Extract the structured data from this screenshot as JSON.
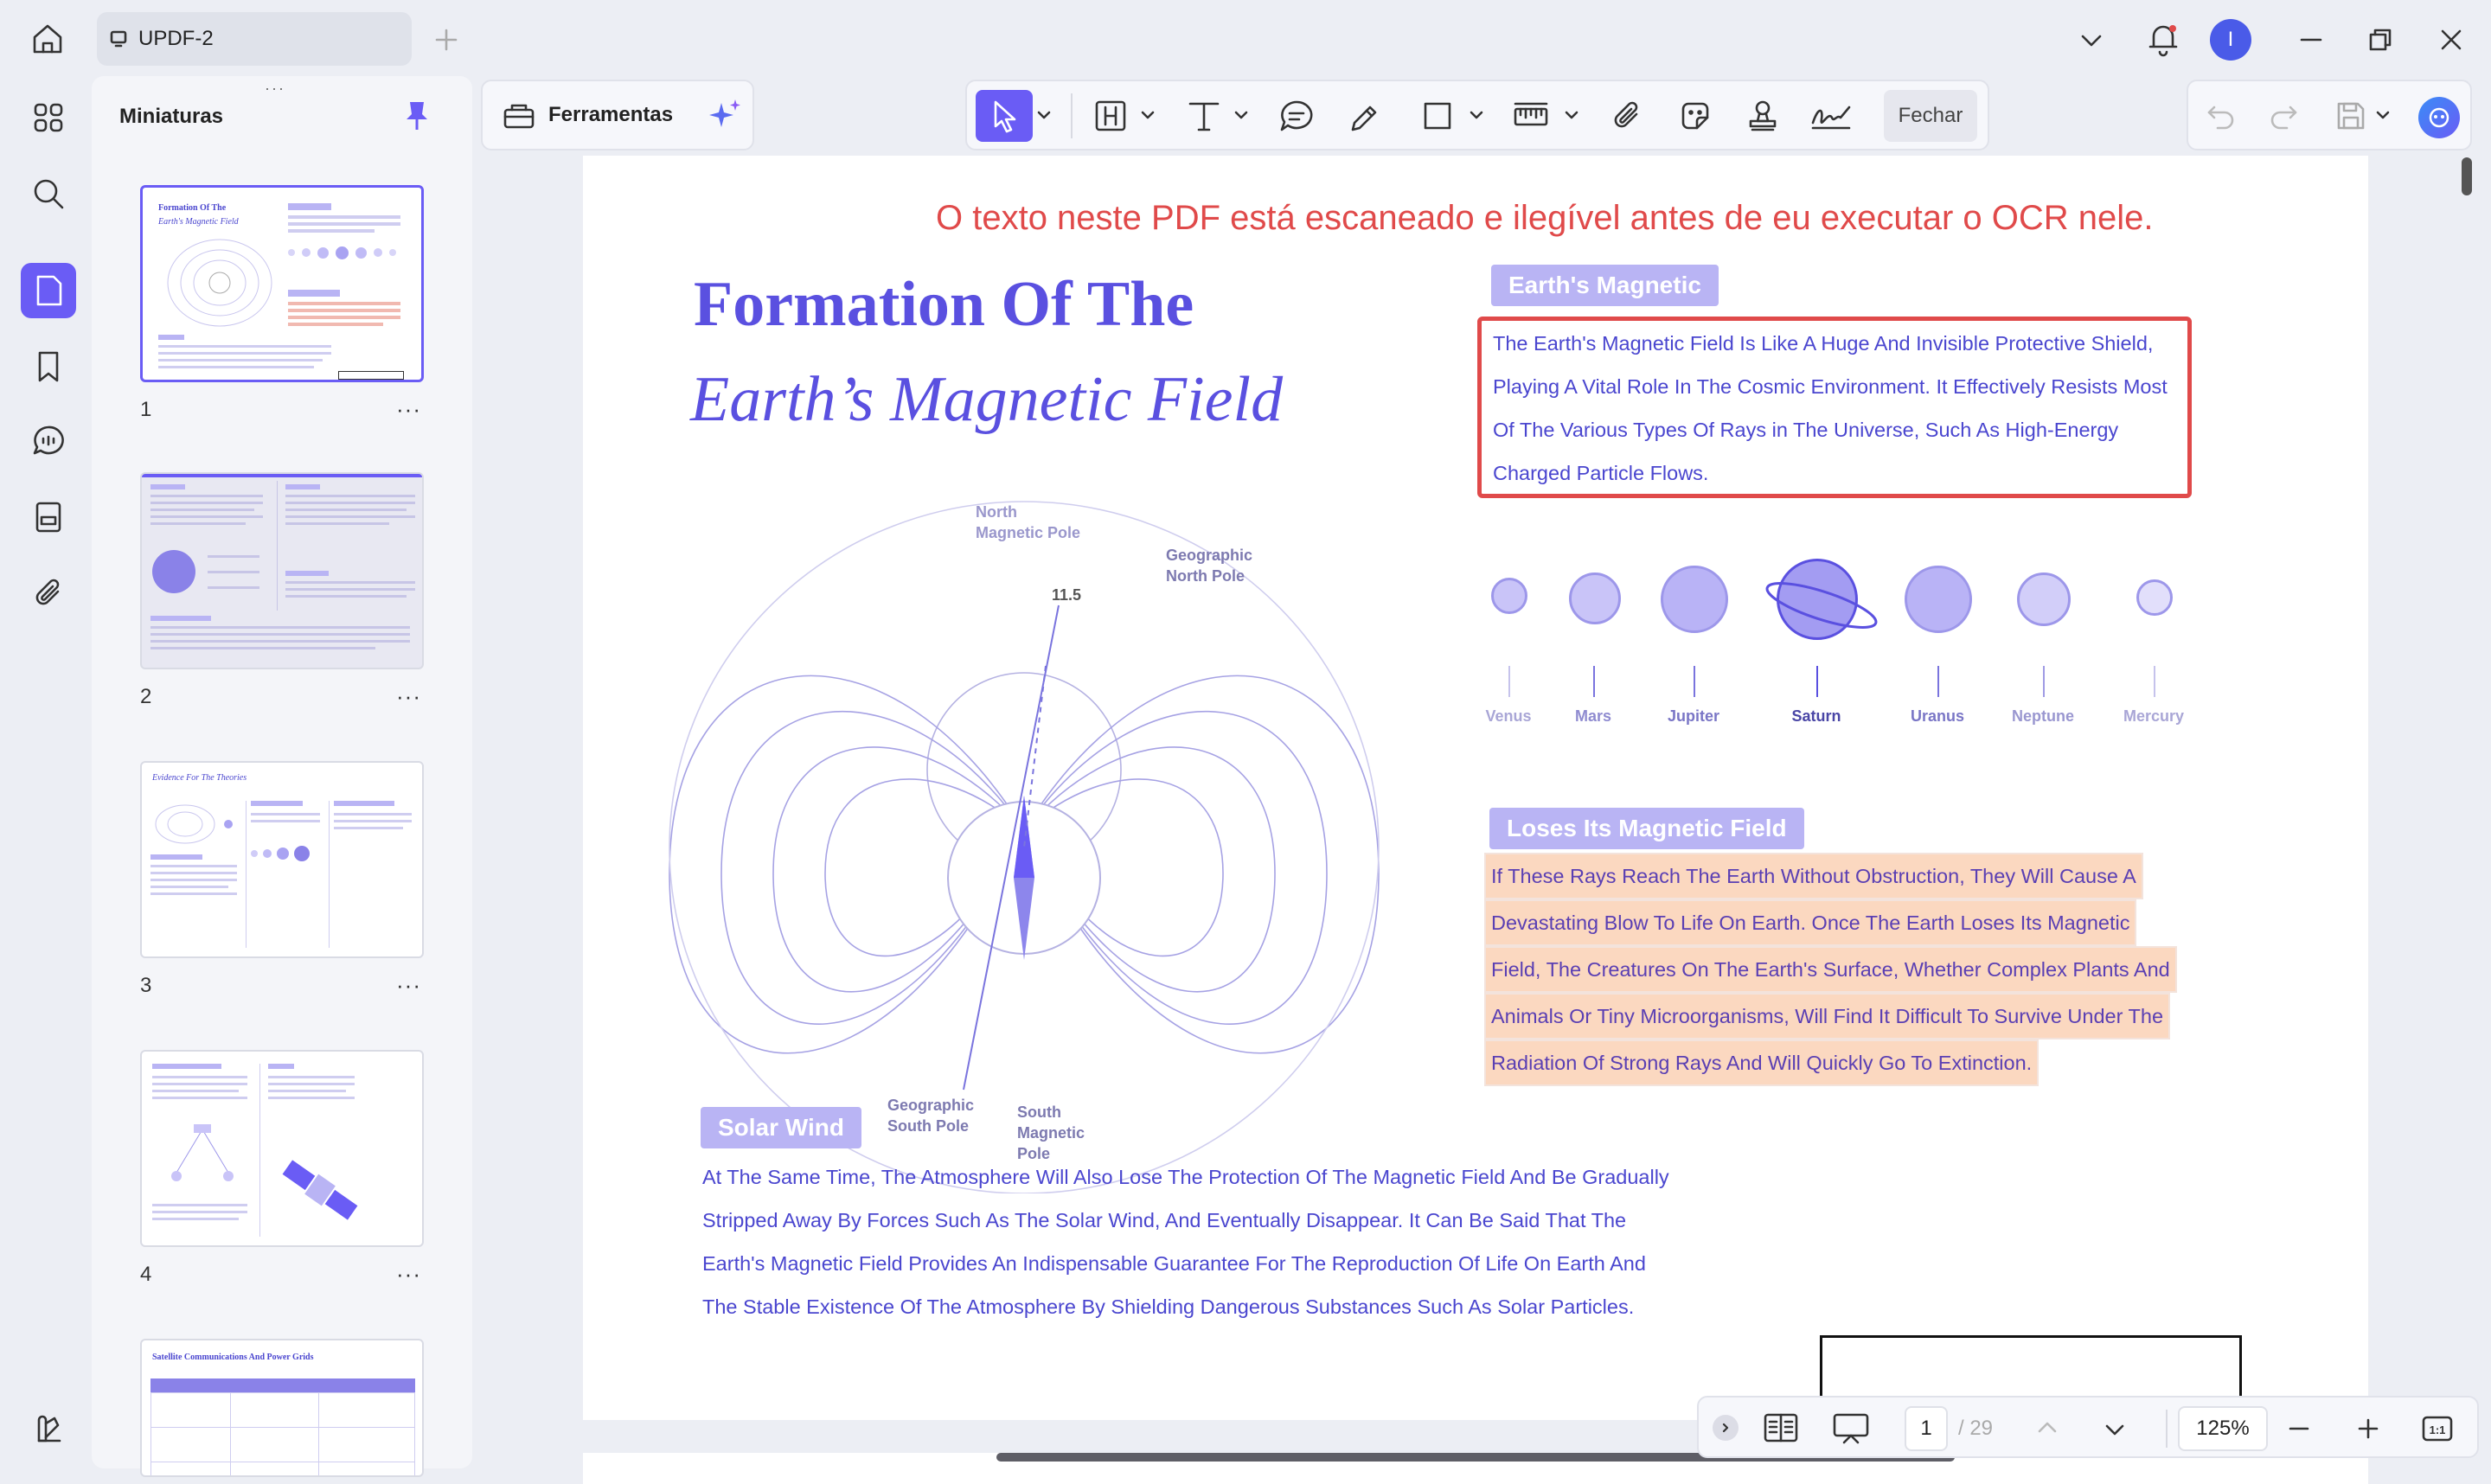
{
  "tab": {
    "title": "UPDF-2"
  },
  "user": {
    "avatar_letter": "I"
  },
  "sidebar": {
    "title": "Miniaturas",
    "thumbnails": [
      {
        "label": "1",
        "more": "···"
      },
      {
        "label": "2",
        "more": "···"
      },
      {
        "label": "3",
        "more": "···"
      },
      {
        "label": "4",
        "more": "···"
      }
    ],
    "thumb_titles": {
      "t1a": "Formation Of The",
      "t1b": "Earth's Magnetic Field",
      "t3": "Evidence For The Theories",
      "t5": "Satellite Communications And Power Grids"
    }
  },
  "toolbar": {
    "tools_label": "Ferramentas",
    "close_label": "Fechar"
  },
  "page_content": {
    "ocr_note": "O texto neste PDF está escaneado e ilegível antes de eu executar o OCR nele.",
    "title_line1": "Formation Of The",
    "title_line2": "Earth’s Magnetic Field",
    "section1_header": "Earth's Magnetic",
    "section1_lines": [
      "The Earth's Magnetic Field Is Like A Huge And Invisible Protective Shield,",
      "Playing A Vital Role In The Cosmic Environment. It Effectively Resists Most",
      "Of The Various Types Of Rays in The Universe, Such As High-Energy",
      "Charged Particle Flows."
    ],
    "diagram_labels": {
      "north_magnetic": "North\nMagnetic Pole",
      "geo_north": "Geographic\nNorth Pole",
      "angle": "11.5",
      "geo_south": "Geographic\nSouth Pole",
      "south_magnetic": "South\nMagnetic\nPole"
    },
    "planets": [
      "Venus",
      "Mars",
      "Jupiter",
      "Saturn",
      "Uranus",
      "Neptune",
      "Mercury"
    ],
    "section2_header": "Loses Its Magnetic Field",
    "section2_lines": [
      "If These Rays Reach The Earth Without Obstruction, They Will Cause A",
      "Devastating Blow To Life On Earth. Once The Earth Loses Its Magnetic",
      "Field, The Creatures On The Earth's Surface, Whether Complex Plants And",
      "Animals Or Tiny Microorganisms, Will Find It Difficult To Survive Under The",
      "Radiation Of Strong Rays And Will Quickly Go To Extinction."
    ],
    "section3_header": "Solar Wind",
    "section3_lines": [
      "At The Same Time, The Atmosphere Will Also Lose The Protection Of The Magnetic Field And Be Gradually",
      "Stripped Away By Forces Such As The Solar Wind, And Eventually Disappear. It Can Be Said That The",
      "Earth's Magnetic Field Provides An Indispensable Guarantee For The Reproduction Of Life On Earth And",
      "The Stable Existence Of The Atmosphere By Shielding Dangerous Substances Such As Solar Particles."
    ]
  },
  "pager": {
    "current_page": "1",
    "total": "/ 29",
    "zoom": "125%"
  },
  "colors": {
    "accent": "#6a5cf5",
    "title_blue": "#5a50e0",
    "note_red": "#e04a4a",
    "highlight": "#fbd8c0"
  }
}
